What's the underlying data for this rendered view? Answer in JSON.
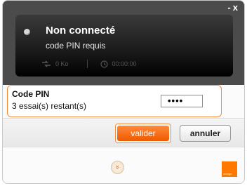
{
  "window": {
    "controls": {
      "minimize": "-",
      "close": "x"
    }
  },
  "status": {
    "title": "Non connecté",
    "subtitle": "code PIN requis",
    "data_transferred": "0 Ko",
    "duration": "00:00:00",
    "data_icon": "transfer-arrows-icon",
    "duration_icon": "clock-icon"
  },
  "pin": {
    "label": "Code PIN",
    "remaining": "3 essai(s) restant(s)",
    "value": "••••"
  },
  "buttons": {
    "validate": "valider",
    "cancel": "annuler"
  },
  "footer": {
    "expand_symbol": "»",
    "brand_logo_text": "orange"
  },
  "colors": {
    "accent": "#f28a3a",
    "validate_button": "#ff7300",
    "brand": "#ff7900"
  }
}
